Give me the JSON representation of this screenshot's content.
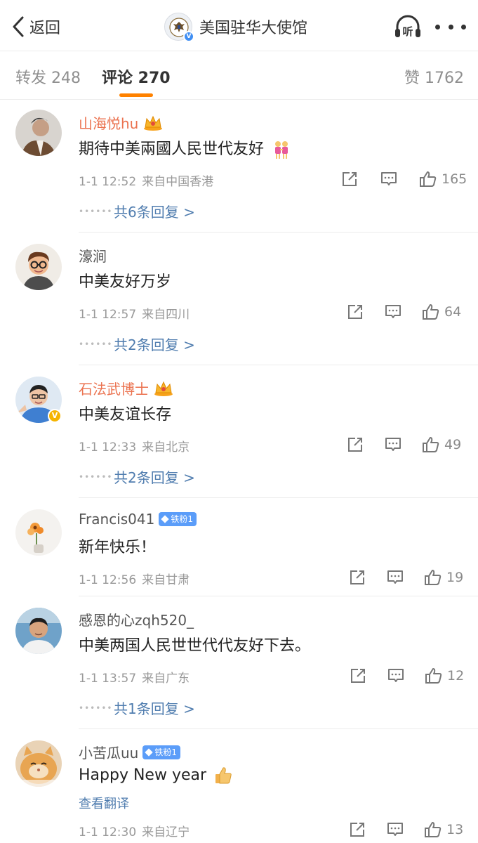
{
  "header": {
    "back_label": "返回",
    "title": "美国驻华大使馆",
    "listen_label": "听",
    "verified_mark": "V"
  },
  "tabs": {
    "repost": "转发 248",
    "comments": "评论 270",
    "likes": "赞 1762"
  },
  "comments": [
    {
      "username": "山海悦hu",
      "badge": "crown-icon",
      "text": "期待中美兩國人民世代友好",
      "emoji": "two-people-holding-hands",
      "time": "1-1 12:52",
      "location": "来自中国香港",
      "likes": "165",
      "replies": "共6条回复 >"
    },
    {
      "username": "濠涧",
      "text": "中美友好万岁",
      "time": "1-1 12:57",
      "location": "来自四川",
      "likes": "64",
      "replies": "共2条回复 >"
    },
    {
      "username": "石法武博士",
      "badge": "crown-icon",
      "verified_mark": "V",
      "text": "中美友谊长存",
      "time": "1-1 12:33",
      "location": "来自北京",
      "likes": "49",
      "replies": "共2条回复 >"
    },
    {
      "username": "Francis041",
      "fan_badge": "铁粉1",
      "text": "新年快乐！",
      "time": "1-1 12:56",
      "location": "来自甘肃",
      "likes": "19"
    },
    {
      "username": "感恩的心zqh520_",
      "text": "中美两国人民世世代代友好下去。",
      "time": "1-1 13:57",
      "location": "来自广东",
      "likes": "12",
      "replies": "共1条回复 >"
    },
    {
      "username": "小苦瓜uu",
      "fan_badge": "铁粉1",
      "text": "Happy New year",
      "emoji": "thumbs-up",
      "translate": "查看翻译",
      "time": "1-1 12:30",
      "location": "来自辽宁",
      "likes": "13"
    }
  ],
  "colors": {
    "accent_orange": "#ff8200",
    "vip_name": "#eb7350",
    "link_blue": "#507daf",
    "fan_badge": "#5b9df9"
  }
}
